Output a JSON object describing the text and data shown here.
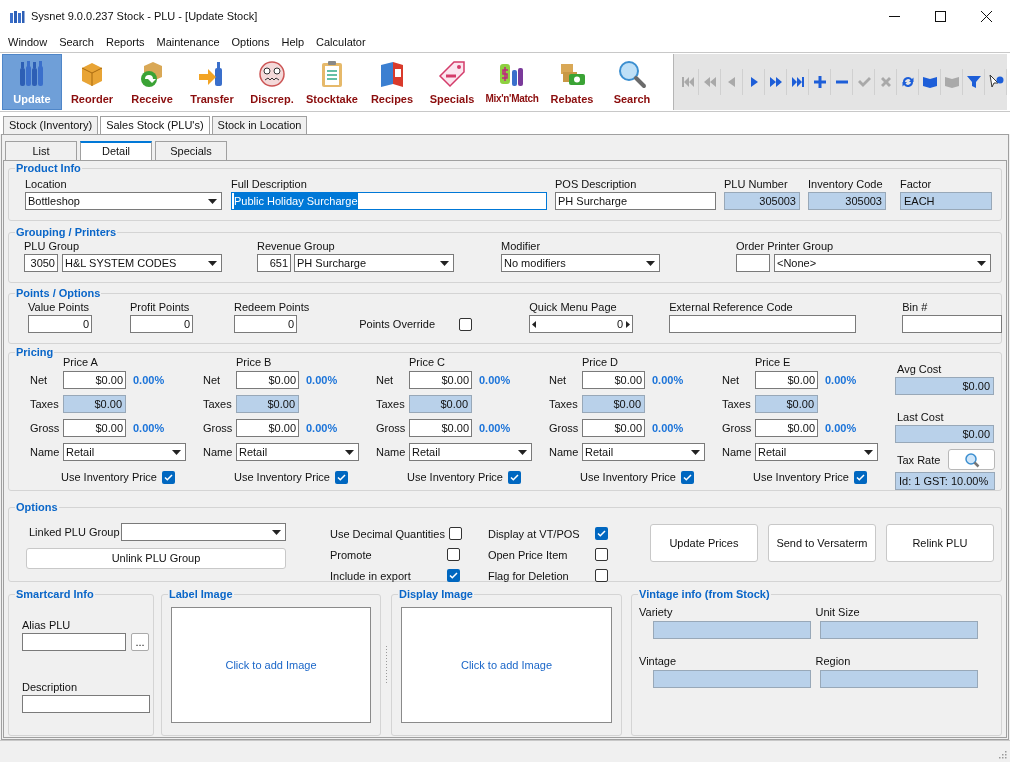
{
  "window": {
    "title": "Sysnet 9.0.0.237 Stock - PLU - [Update Stock]"
  },
  "menu": [
    "Window",
    "Search",
    "Reports",
    "Maintenance",
    "Options",
    "Help",
    "Calculator"
  ],
  "toolbar": [
    {
      "label": "Update",
      "selected": true
    },
    {
      "label": "Reorder",
      "selected": false
    },
    {
      "label": "Receive",
      "selected": false
    },
    {
      "label": "Transfer",
      "selected": false
    },
    {
      "label": "Discrep.",
      "selected": false
    },
    {
      "label": "Stocktake",
      "selected": false
    },
    {
      "label": "Recipes",
      "selected": false
    },
    {
      "label": "Specials",
      "selected": false
    },
    {
      "label": "Mix'n'Match",
      "selected": false
    },
    {
      "label": "Rebates",
      "selected": false
    },
    {
      "label": "Search",
      "selected": false
    }
  ],
  "nav_buttons": [
    {
      "disabled": true
    },
    {
      "disabled": true
    },
    {
      "disabled": true
    },
    {
      "disabled": false
    },
    {
      "disabled": false
    },
    {
      "disabled": false
    },
    {
      "disabled": false
    },
    {
      "disabled": false
    },
    {
      "disabled": true
    },
    {
      "disabled": true
    },
    {
      "disabled": false
    },
    {
      "disabled": false
    },
    {
      "disabled": true
    },
    {
      "disabled": false
    },
    {
      "disabled": false
    }
  ],
  "tabs": [
    {
      "label": "Stock (Inventory)",
      "selected": false
    },
    {
      "label": "Sales Stock (PLU's)",
      "selected": true
    },
    {
      "label": "Stock in Location",
      "selected": false
    }
  ],
  "subtabs": [
    {
      "label": "List",
      "selected": false
    },
    {
      "label": "Detail",
      "selected": true
    },
    {
      "label": "Specials",
      "selected": false
    }
  ],
  "product_info": {
    "title": "Product Info",
    "location": {
      "label": "Location",
      "value": "Bottleshop"
    },
    "full_description": {
      "label": "Full Description",
      "value": "Public Holiday Surcharge",
      "highlighted": true
    },
    "pos_description": {
      "label": "POS Description",
      "value": "PH Surcharge"
    },
    "plu_number": {
      "label": "PLU Number",
      "value": "305003"
    },
    "inventory_code": {
      "label": "Inventory Code",
      "value": "305003"
    },
    "factor": {
      "label": "Factor",
      "value": "EACH"
    }
  },
  "grouping": {
    "title": "Grouping / Printers",
    "plu_group": {
      "label": "PLU Group",
      "code": "3050",
      "value": "H&L SYSTEM CODES"
    },
    "revenue_group": {
      "label": "Revenue Group",
      "code": "651",
      "value": "PH Surcharge"
    },
    "modifier": {
      "label": "Modifier",
      "value": "No modifiers"
    },
    "order_printer_group": {
      "label": "Order Printer Group",
      "value": "<None>"
    }
  },
  "points": {
    "title": "Points / Options",
    "value_points": {
      "label": "Value Points",
      "value": "0"
    },
    "profit_points": {
      "label": "Profit Points",
      "value": "0"
    },
    "redeem_points": {
      "label": "Redeem Points",
      "value": "0"
    },
    "points_override": {
      "label": "Points Override",
      "checked": false
    },
    "quick_menu_page": {
      "label": "Quick Menu Page",
      "value": "0"
    },
    "external_reference_code": {
      "label": "External Reference Code"
    },
    "bin": {
      "label": "Bin #"
    }
  },
  "pricing": {
    "title": "Pricing",
    "columns": [
      {
        "title": "Price A",
        "rows": [
          {
            "kind": "input",
            "label": "Net",
            "value": "$0.00",
            "percent": "0.00%"
          },
          {
            "kind": "readonly",
            "label": "Taxes",
            "value": "$0.00"
          },
          {
            "kind": "input",
            "label": "Gross",
            "value": "$0.00",
            "percent": "0.00%"
          },
          {
            "kind": "combo",
            "label": "Name",
            "value": "Retail"
          }
        ],
        "use_inventory_price": {
          "label": "Use Inventory Price",
          "checked": true
        }
      },
      {
        "title": "Price B",
        "rows": [
          {
            "kind": "input",
            "label": "Net",
            "value": "$0.00",
            "percent": "0.00%"
          },
          {
            "kind": "readonly",
            "label": "Taxes",
            "value": "$0.00"
          },
          {
            "kind": "input",
            "label": "Gross",
            "value": "$0.00",
            "percent": "0.00%"
          },
          {
            "kind": "combo",
            "label": "Name",
            "value": "Retail"
          }
        ],
        "use_inventory_price": {
          "label": "Use Inventory Price",
          "checked": true
        }
      },
      {
        "title": "Price C",
        "rows": [
          {
            "kind": "input",
            "label": "Net",
            "value": "$0.00",
            "percent": "0.00%"
          },
          {
            "kind": "readonly",
            "label": "Taxes",
            "value": "$0.00"
          },
          {
            "kind": "input",
            "label": "Gross",
            "value": "$0.00",
            "percent": "0.00%"
          },
          {
            "kind": "combo",
            "label": "Name",
            "value": "Retail"
          }
        ],
        "use_inventory_price": {
          "label": "Use Inventory Price",
          "checked": true
        }
      },
      {
        "title": "Price D",
        "rows": [
          {
            "kind": "input",
            "label": "Net",
            "value": "$0.00",
            "percent": "0.00%"
          },
          {
            "kind": "readonly",
            "label": "Taxes",
            "value": "$0.00"
          },
          {
            "kind": "input",
            "label": "Gross",
            "value": "$0.00",
            "percent": "0.00%"
          },
          {
            "kind": "combo",
            "label": "Name",
            "value": "Retail"
          }
        ],
        "use_inventory_price": {
          "label": "Use Inventory Price",
          "checked": true
        }
      },
      {
        "title": "Price E",
        "rows": [
          {
            "kind": "input",
            "label": "Net",
            "value": "$0.00",
            "percent": "0.00%"
          },
          {
            "kind": "readonly",
            "label": "Taxes",
            "value": "$0.00"
          },
          {
            "kind": "input",
            "label": "Gross",
            "value": "$0.00",
            "percent": "0.00%"
          },
          {
            "kind": "combo",
            "label": "Name",
            "value": "Retail"
          }
        ],
        "use_inventory_price": {
          "label": "Use Inventory Price",
          "checked": true
        }
      }
    ],
    "avg_cost": {
      "label": "Avg Cost",
      "value": "$0.00"
    },
    "last_cost": {
      "label": "Last Cost",
      "value": "$0.00"
    },
    "tax_rate": {
      "label": "Tax Rate"
    },
    "tax_info": "Id: 1 GST: 10.00%"
  },
  "options": {
    "title": "Options",
    "linked_plu_group": {
      "label": "Linked PLU Group"
    },
    "unlink_button": "Unlink PLU Group",
    "checkboxes": [
      {
        "label": "Use Decimal Quantities",
        "checked": false
      },
      {
        "label": "Promote",
        "checked": false
      },
      {
        "label": "Include in export",
        "checked": true
      },
      {
        "label": "Display at VT/POS",
        "checked": true
      },
      {
        "label": "Open Price Item",
        "checked": false
      },
      {
        "label": "Flag for Deletion",
        "checked": false
      }
    ],
    "buttons": [
      "Update Prices",
      "Send to Versaterm",
      "Relink PLU"
    ]
  },
  "smartcard": {
    "title": "Smartcard Info",
    "alias_plu": {
      "label": "Alias PLU"
    },
    "browse_button": "...",
    "description": {
      "label": "Description"
    }
  },
  "label_image": {
    "title": "Label Image",
    "hint": "Click to add Image"
  },
  "display_image": {
    "title": "Display Image",
    "hint": "Click to add Image"
  },
  "vintage": {
    "title": "Vintage info (from Stock)",
    "fields": [
      {
        "label": "Variety"
      },
      {
        "label": "Unit Size"
      },
      {
        "label": "Vintage"
      },
      {
        "label": "Region"
      }
    ]
  }
}
